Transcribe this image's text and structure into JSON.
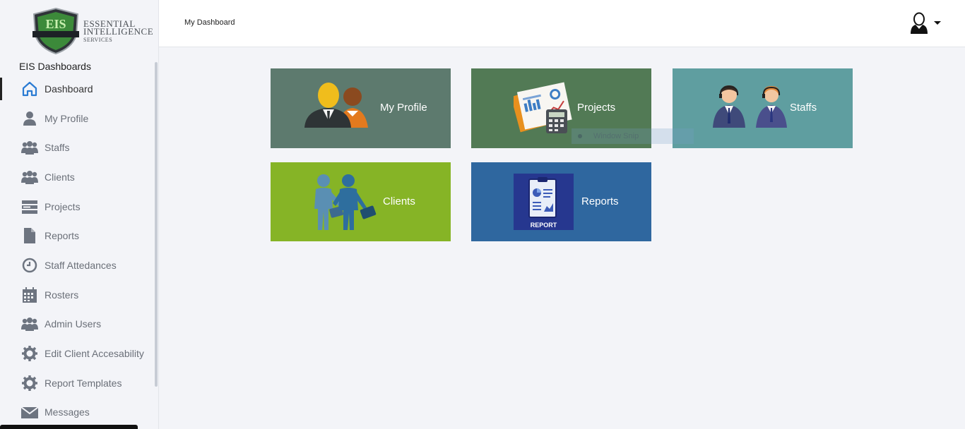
{
  "brand": {
    "logo_badge": "EIS",
    "line1": "ESSENTIAL",
    "line2": "INTELLIGENCE",
    "line3": "SERVICES"
  },
  "sidebar": {
    "heading": "EIS Dashboards",
    "items": [
      {
        "label": "Dashboard",
        "icon": "home-icon",
        "active": true
      },
      {
        "label": "My Profile",
        "icon": "user-icon"
      },
      {
        "label": "Staffs",
        "icon": "users-icon"
      },
      {
        "label": "Clients",
        "icon": "users-icon"
      },
      {
        "label": "Projects",
        "icon": "server-icon"
      },
      {
        "label": "Reports",
        "icon": "file-icon"
      },
      {
        "label": "Staff Attedances",
        "icon": "clock-icon"
      },
      {
        "label": "Rosters",
        "icon": "calendar-icon"
      },
      {
        "label": "Admin Users",
        "icon": "users-icon"
      },
      {
        "label": "Edit Client Accesability",
        "icon": "gear-icon"
      },
      {
        "label": "Report Templates",
        "icon": "gear-icon"
      },
      {
        "label": "Messages",
        "icon": "envelope-icon"
      }
    ]
  },
  "header": {
    "breadcrumb": "My Dashboard",
    "user_icon": "user-avatar-icon"
  },
  "tiles": {
    "profile": {
      "label": "My Profile",
      "color": "#5d7a6e"
    },
    "projects": {
      "label": "Projects",
      "color": "#527a55"
    },
    "staffs": {
      "label": "Staffs",
      "color": "#5f9ea0"
    },
    "clients": {
      "label": "Clients",
      "color": "#86b426"
    },
    "reports": {
      "label": "Reports",
      "color": "#2f679f",
      "badge": "REPORT"
    }
  },
  "overlay": {
    "snip_label": "Window Snip"
  }
}
